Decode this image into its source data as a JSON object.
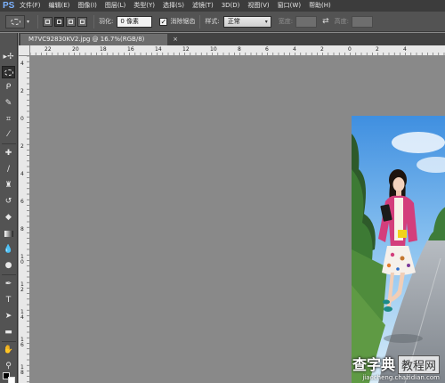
{
  "app": {
    "logo": "PS"
  },
  "menu": [
    "文件(F)",
    "编辑(E)",
    "图像(I)",
    "图层(L)",
    "类型(Y)",
    "选择(S)",
    "滤镜(T)",
    "3D(D)",
    "视图(V)",
    "窗口(W)",
    "帮助(H)"
  ],
  "options": {
    "feather_label": "羽化:",
    "feather_value": "0 像素",
    "antialias_label": "消除锯齿",
    "antialias_checked": "✓",
    "style_label": "样式:",
    "style_value": "正常",
    "width_label": "宽度:",
    "height_label": "高度:",
    "swap_icon": "⇄"
  },
  "document": {
    "tab_title": "M7VC92830KV2.jpg @ 16.7%(RGB/8)",
    "close": "×"
  },
  "ruler": {
    "h_labels": [
      "22",
      "20",
      "18",
      "16",
      "14",
      "12",
      "10",
      "8",
      "6",
      "4",
      "2",
      "0",
      "2",
      "4"
    ],
    "v_labels": [
      "4",
      "2",
      "0",
      "2",
      "4",
      "6",
      "8",
      "1 0",
      "1 2",
      "1 4",
      "1 6",
      "1 8"
    ]
  },
  "watermark": {
    "main": "查字典",
    "box": "教程网",
    "sub": "jiaocheng.chazidian.com"
  },
  "colors": {
    "menubar": "#3c3c3c",
    "panel": "#535353",
    "canvas_bg": "#898989",
    "accent": "#7db3ff"
  }
}
